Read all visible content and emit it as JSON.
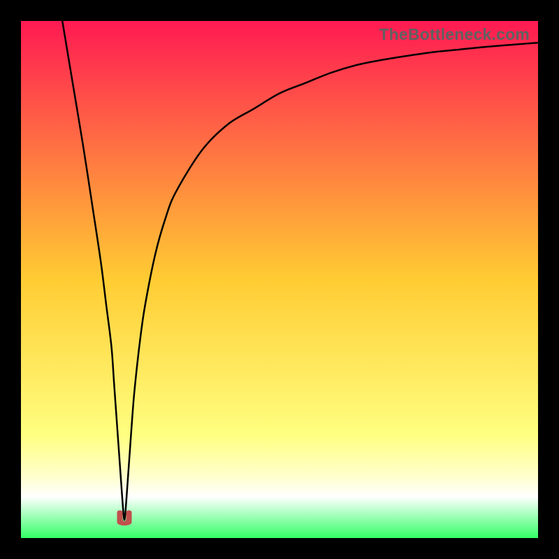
{
  "watermark": {
    "text": "TheBottleneck.com"
  },
  "chart_data": {
    "type": "line",
    "title": "",
    "xlabel": "",
    "ylabel": "",
    "xlim": [
      0,
      100
    ],
    "ylim": [
      0,
      100
    ],
    "grid": false,
    "legend": false,
    "background_gradient": [
      {
        "color": "#ff1a52",
        "stop": 0
      },
      {
        "color": "#ffcc33",
        "stop": 50
      },
      {
        "color": "#ffff80",
        "stop": 80
      },
      {
        "color": "#ffffcc",
        "stop": 88
      },
      {
        "color": "#ffffff",
        "stop": 92
      },
      {
        "color": "#33ff66",
        "stop": 100
      }
    ],
    "series": [
      {
        "name": "bottleneck-curve",
        "x": [
          8,
          10,
          12,
          14,
          15.5,
          16.5,
          17.5,
          18,
          18.5,
          19,
          19.5,
          19.8,
          20,
          20.2,
          20.5,
          21,
          21.5,
          22,
          23,
          24,
          26,
          28,
          30,
          35,
          40,
          45,
          50,
          55,
          60,
          65,
          70,
          75,
          80,
          85,
          90,
          95,
          100
        ],
        "y": [
          100,
          88,
          76,
          63,
          53,
          45,
          37,
          30,
          23,
          16,
          9,
          5,
          3.5,
          5,
          9,
          16,
          23,
          29,
          38,
          45,
          55,
          62,
          67,
          75,
          80,
          83,
          86,
          88,
          90,
          91.5,
          92.5,
          93.3,
          94,
          94.5,
          95,
          95.4,
          95.8
        ]
      },
      {
        "name": "minimum-marker",
        "shape": "u-blob",
        "x": 20,
        "y": 3.5,
        "color": "#c0504d"
      }
    ]
  }
}
